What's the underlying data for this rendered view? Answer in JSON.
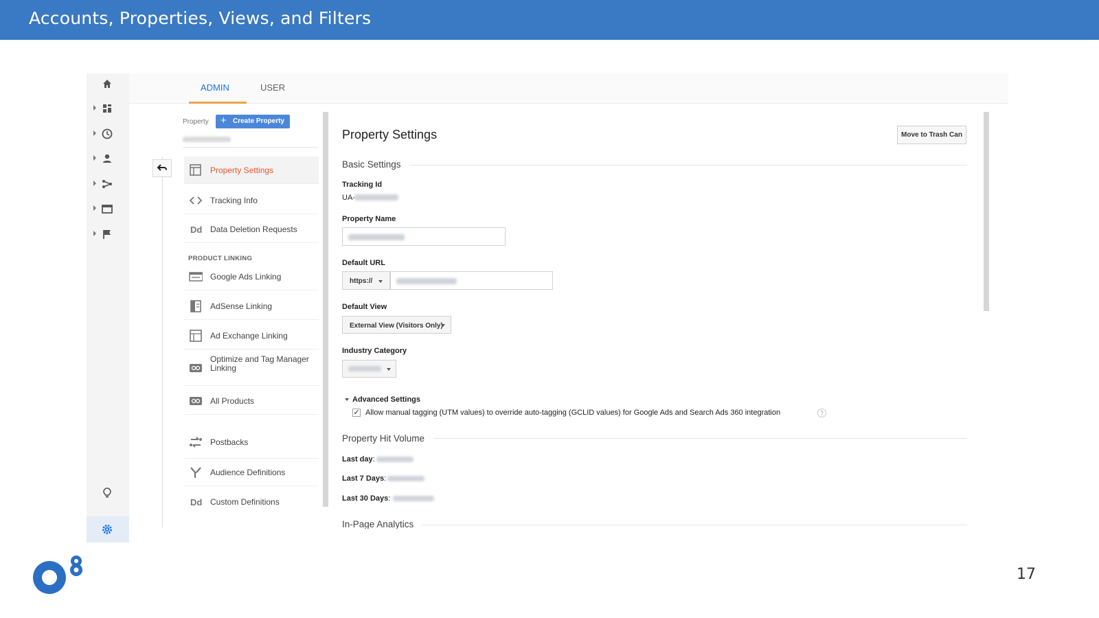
{
  "slide": {
    "title": "Accounts, Properties, Views, and Filters",
    "page_number": "17",
    "brand_color": "#3a79c3"
  },
  "rail": {
    "icons": [
      "home-icon",
      "dashboard-icon",
      "clock-icon",
      "person-icon",
      "acquisition-icon",
      "behavior-icon",
      "flag-icon",
      "lightbulb-icon",
      "gear-icon"
    ]
  },
  "tabs": {
    "admin": "ADMIN",
    "user": "USER"
  },
  "property": {
    "label": "Property",
    "create_button": "Create Property"
  },
  "menu": {
    "items": [
      {
        "label": "Property Settings",
        "icon": "settings-page-icon"
      },
      {
        "label": "Tracking Info",
        "icon": "code-icon"
      },
      {
        "label": "Data Deletion Requests",
        "icon": "dd-icon"
      },
      {
        "label": "Google Ads Linking",
        "icon": "ads-icon"
      },
      {
        "label": "AdSense Linking",
        "icon": "adsense-icon"
      },
      {
        "label": "Ad Exchange Linking",
        "icon": "adexchange-icon"
      },
      {
        "label": "Optimize and Tag Manager Linking",
        "icon": "link-icon"
      },
      {
        "label": "All Products",
        "icon": "link-icon"
      },
      {
        "label": "Postbacks",
        "icon": "postbacks-icon"
      },
      {
        "label": "Audience Definitions",
        "icon": "audience-icon"
      },
      {
        "label": "Custom Definitions",
        "icon": "dd-icon"
      }
    ],
    "product_linking_heading": "PRODUCT LINKING"
  },
  "panel": {
    "title": "Property Settings",
    "trash_button": "Move to Trash Can",
    "basic_settings": "Basic Settings",
    "tracking_id_label": "Tracking Id",
    "tracking_id_prefix": "UA-",
    "property_name_label": "Property Name",
    "default_url_label": "Default URL",
    "protocol": "https://",
    "default_view_label": "Default View",
    "default_view_value": "External View (Visitors Only)",
    "industry_label": "Industry Category",
    "advanced_settings": "Advanced Settings",
    "manual_tagging_text": "Allow manual tagging (UTM values) to override auto-tagging (GCLID values) for Google Ads and Search Ads 360 integration",
    "help_glyph": "?",
    "hit_volume": "Property Hit Volume",
    "last_day": "Last day",
    "last_7": "Last 7 Days",
    "last_30": "Last 30 Days",
    "in_page": "In-Page Analytics"
  }
}
